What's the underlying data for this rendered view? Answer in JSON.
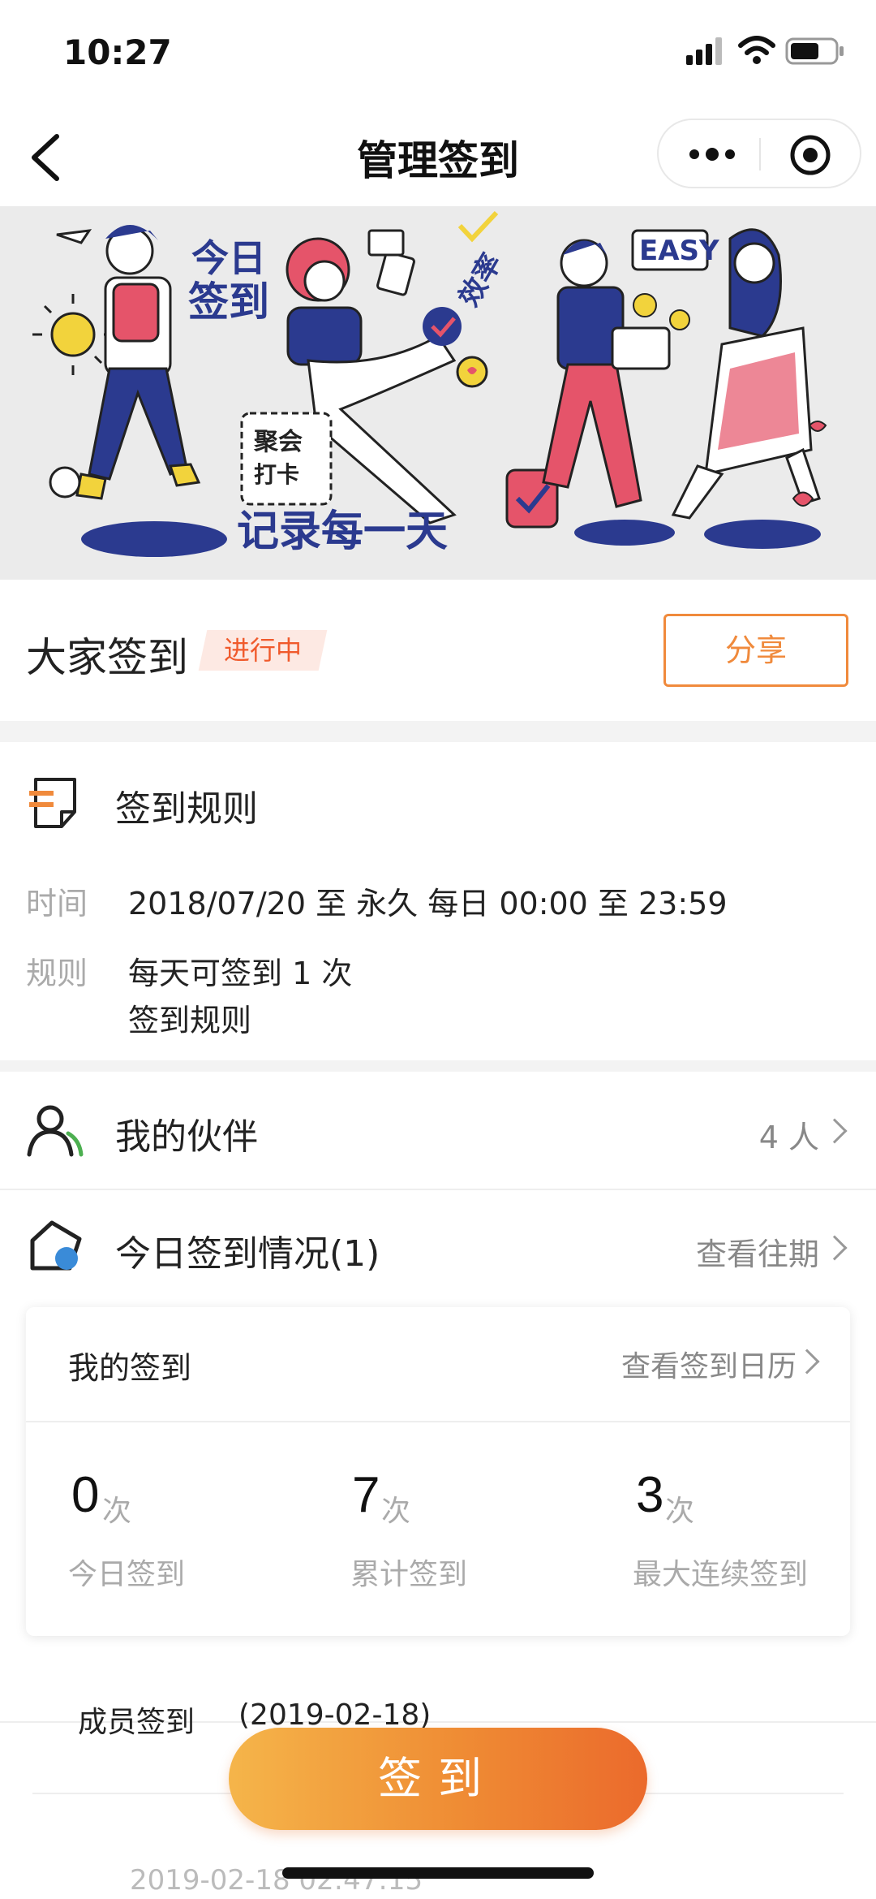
{
  "status_bar": {
    "time": "10:27"
  },
  "nav": {
    "title": "管理签到"
  },
  "banner": {
    "texts": {
      "jinri": "今日",
      "qiandao": "签到",
      "juhui": "聚会",
      "daka": "打卡",
      "jilu": "记录每一天",
      "easy": "EASY",
      "xiaolv": "效率"
    },
    "colors": {
      "navy": "#2b3a8f",
      "pink": "#e5546a",
      "yellow": "#f2d33c",
      "bg": "#ebebeb"
    }
  },
  "group": {
    "title": "大家签到",
    "status": "进行中",
    "share_label": "分享"
  },
  "rules": {
    "title": "签到规则",
    "time_label": "时间",
    "time_value": "2018/07/20 至 永久 每日 00:00 至 23:59",
    "rule_label": "规则",
    "rule_value": "每天可签到 1 次",
    "rule_link": "签到规则"
  },
  "partners": {
    "title": "我的伙伴",
    "count": "4 人"
  },
  "today": {
    "title": "今日签到情况(1)",
    "history_link": "查看往期"
  },
  "my_card": {
    "title": "我的签到",
    "calendar_link": "查看签到日历",
    "stats": [
      {
        "value": "0",
        "unit": "次",
        "label": "今日签到"
      },
      {
        "value": "7",
        "unit": "次",
        "label": "累计签到"
      },
      {
        "value": "3",
        "unit": "次",
        "label": "最大连续签到"
      }
    ]
  },
  "members": {
    "title": "成员签到",
    "date": "(2019-02-18)",
    "entry_time": "2019-02-18 02:47:15"
  },
  "checkin_button": {
    "label": "签到"
  },
  "accent": "#f08a3c"
}
